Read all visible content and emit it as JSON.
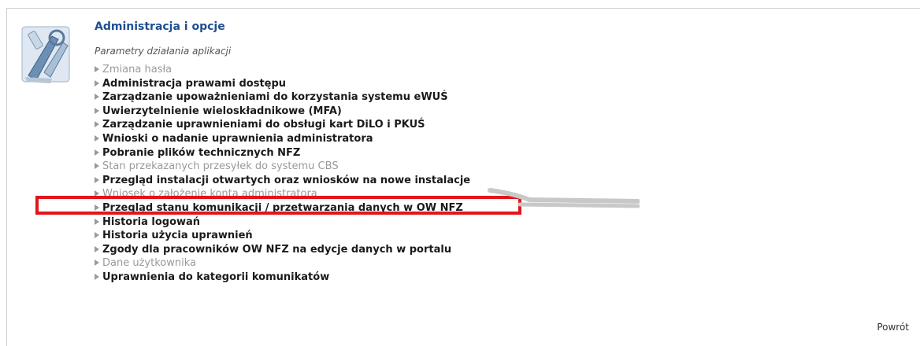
{
  "section": {
    "title": "Administracja i opcje",
    "subtitle": "Parametry działania aplikacji"
  },
  "menu": [
    {
      "label": "Zmiana hasła",
      "enabled": false
    },
    {
      "label": "Administracja prawami dostępu",
      "enabled": true
    },
    {
      "label": "Zarządzanie upoważnieniami do korzystania systemu eWUŚ",
      "enabled": true
    },
    {
      "label": "Uwierzytelnienie wieloskładnikowe (MFA)",
      "enabled": true
    },
    {
      "label": "Zarządzanie uprawnieniami do obsługi kart DiLO i PKUŚ",
      "enabled": true
    },
    {
      "label": "Wnioski o nadanie uprawnienia administratora",
      "enabled": true
    },
    {
      "label": "Pobranie plików technicznych NFZ",
      "enabled": true
    },
    {
      "label": "Stan przekazanych przesyłek do systemu CBS",
      "enabled": false
    },
    {
      "label": "Przegląd instalacji otwartych oraz wniosków na nowe instalacje",
      "enabled": true,
      "highlighted": true
    },
    {
      "label": "Wniosek o założenie konta administratora",
      "enabled": false
    },
    {
      "label": "Przegląd stanu komunikacji / przetwarzania danych w OW NFZ",
      "enabled": true
    },
    {
      "label": "Historia logowań",
      "enabled": true
    },
    {
      "label": "Historia użycia uprawnień",
      "enabled": true
    },
    {
      "label": "Zgody dla pracowników OW NFZ na edycje danych w portalu",
      "enabled": true
    },
    {
      "label": "Dane użytkownika",
      "enabled": false
    },
    {
      "label": "Uprawnienia do kategorii komunikatów",
      "enabled": true
    }
  ],
  "footer": {
    "back_label": "Powrót"
  },
  "colors": {
    "title": "#1f4f8f",
    "highlight": "#e3141b",
    "disabled": "#9a9a9a"
  }
}
